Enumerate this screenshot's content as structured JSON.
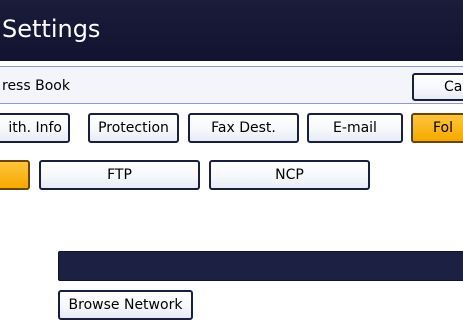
{
  "window": {
    "title": "Settings"
  },
  "address_row": {
    "label": "ress Book"
  },
  "buttons": {
    "cancel": "Car"
  },
  "tabs": [
    {
      "label": "ith. Info"
    },
    {
      "label": "Protection"
    },
    {
      "label": "Fax Dest."
    },
    {
      "label": "E-mail"
    },
    {
      "label": "Fol"
    }
  ],
  "subtabs": [
    {
      "label": ""
    },
    {
      "label": "FTP"
    },
    {
      "label": "NCP"
    }
  ],
  "path_field": {
    "value": ""
  },
  "browse": {
    "label": "Browse Network"
  },
  "colors": {
    "title_bar": "#16172f",
    "selected": "#ffbf33",
    "button_border": "#19203f",
    "path_field": "#1c2042"
  }
}
